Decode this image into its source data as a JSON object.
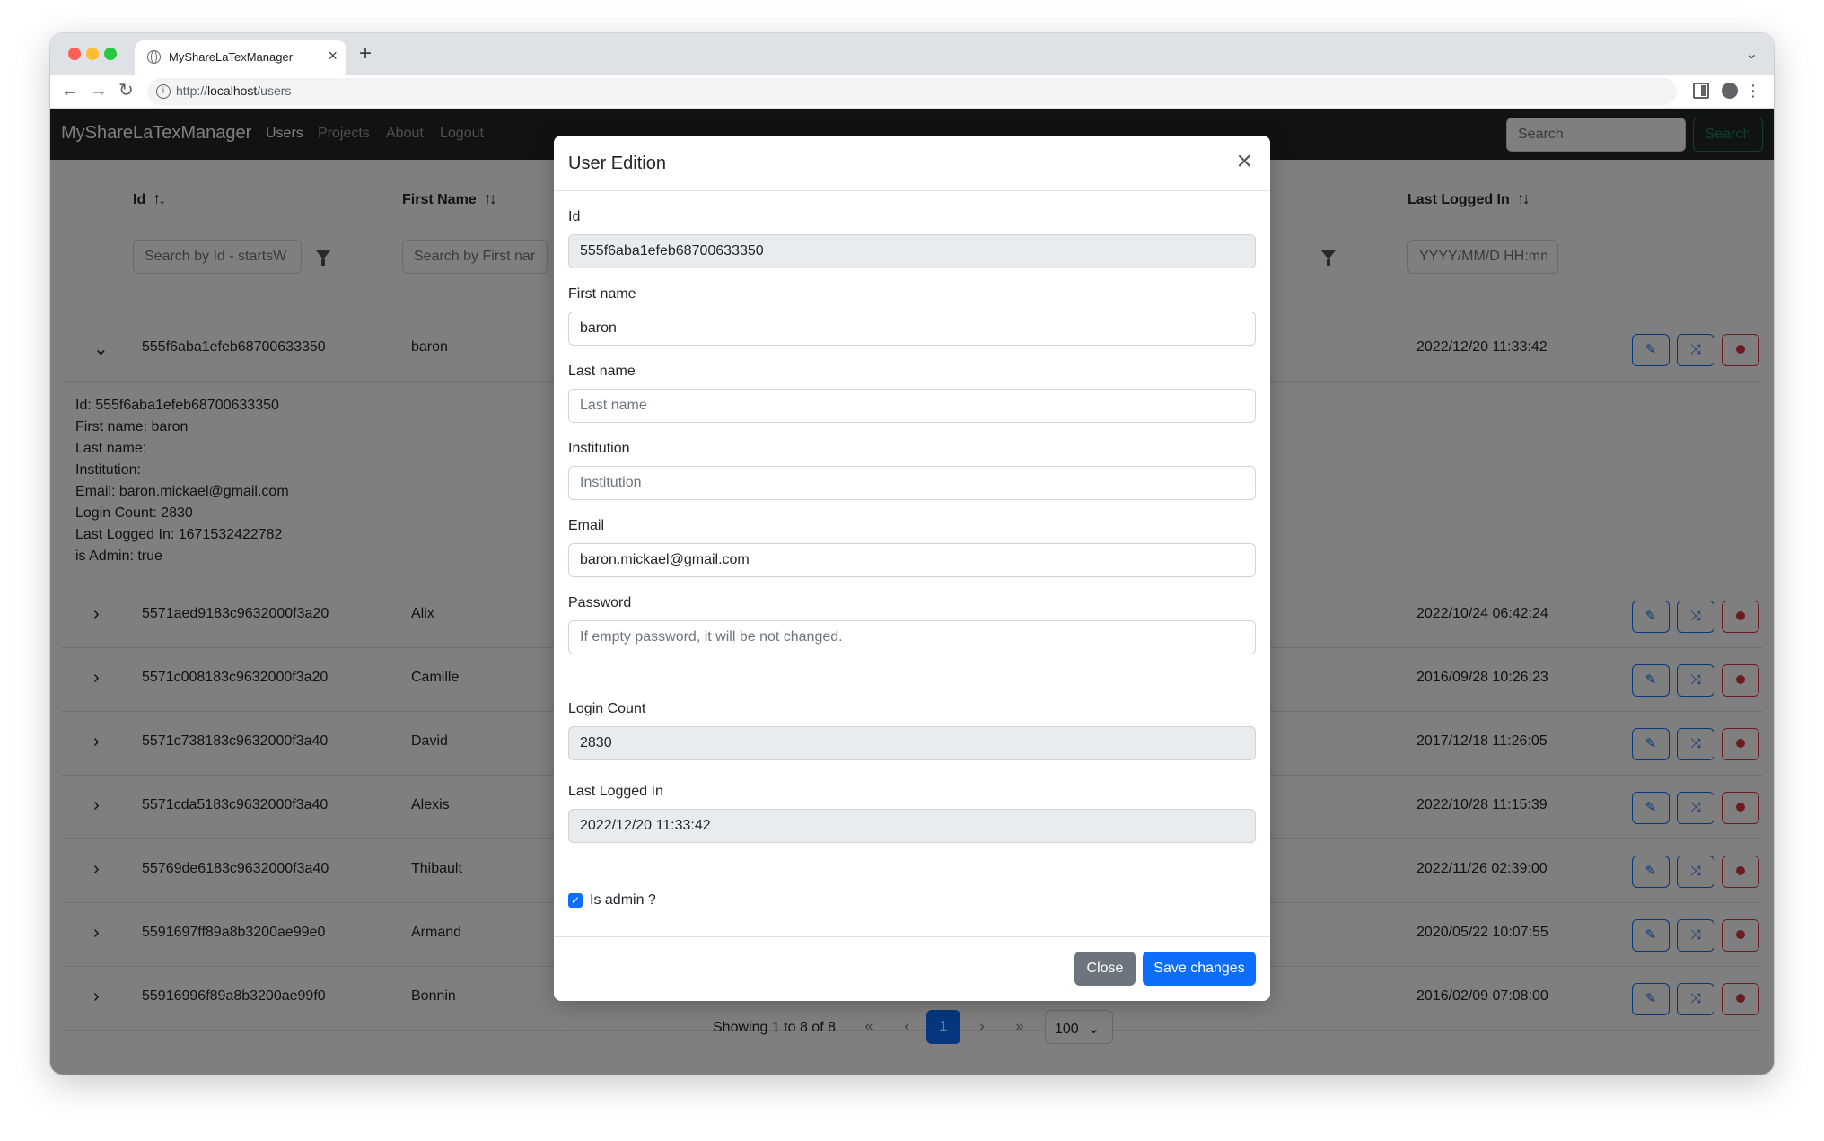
{
  "browser": {
    "tab_title": "MyShareLaTexManager",
    "url_prefix": "http://",
    "url_host": "localhost",
    "url_path": "/users"
  },
  "navbar": {
    "brand": "MyShareLaTexManager",
    "links": [
      "Users",
      "Projects",
      "About",
      "Logout"
    ],
    "search_placeholder": "Search",
    "search_button": "Search"
  },
  "table": {
    "headers": {
      "id": "Id",
      "first_name": "First Name",
      "last_logged_in": "Last Logged In"
    },
    "filters": {
      "id_placeholder": "Search by Id - startsW",
      "first_name_placeholder": "Search by First nar",
      "date_placeholder": "YYYY/MM/D HH:mn"
    },
    "rows": [
      {
        "id": "555f6aba1efeb68700633350",
        "first_name": "baron",
        "last_logged_in": "2022/12/20 11:33:42"
      },
      {
        "id": "5571aed9183c9632000f3a20",
        "first_name": "Alix",
        "last_logged_in": "2022/10/24 06:42:24"
      },
      {
        "id": "5571c008183c9632000f3a20",
        "first_name": "Camille",
        "last_logged_in": "2016/09/28 10:26:23"
      },
      {
        "id": "5571c738183c9632000f3a40",
        "first_name": "David",
        "last_logged_in": "2017/12/18 11:26:05"
      },
      {
        "id": "5571cda5183c9632000f3a40",
        "first_name": "Alexis",
        "last_logged_in": "2022/10/28 11:15:39"
      },
      {
        "id": "55769de6183c9632000f3a40",
        "first_name": "Thibault",
        "last_logged_in": "2022/11/26 02:39:00"
      },
      {
        "id": "5591697ff89a8b3200ae99e0",
        "first_name": "Armand",
        "last_logged_in": "2020/05/22 10:07:55"
      },
      {
        "id": "55916996f89a8b3200ae99f0",
        "first_name": "Bonnin",
        "last_logged_in": "2016/02/09 07:08:00"
      }
    ],
    "expanded_details": [
      "Id: 555f6aba1efeb68700633350",
      "First name: baron",
      "Last name:",
      "Institution:",
      "Email: baron.mickael@gmail.com",
      "Login Count: 2830",
      "Last Logged In: 1671532422782",
      "is Admin: true"
    ],
    "pagination": {
      "summary": "Showing 1 to 8 of 8",
      "first": "«",
      "prev": "‹",
      "current": "1",
      "next": "›",
      "last": "»",
      "page_size": "100"
    }
  },
  "modal": {
    "title": "User Edition",
    "fields": {
      "id_label": "Id",
      "id_value": "555f6aba1efeb68700633350",
      "first_name_label": "First name",
      "first_name_value": "baron",
      "last_name_label": "Last name",
      "last_name_placeholder": "Last name",
      "institution_label": "Institution",
      "institution_placeholder": "Institution",
      "email_label": "Email",
      "email_value": "baron.mickael@gmail.com",
      "password_label": "Password",
      "password_placeholder": "If empty password, it will be not changed.",
      "login_count_label": "Login Count",
      "login_count_value": "2830",
      "last_logged_label": "Last Logged In",
      "last_logged_value": "2022/12/20 11:33:42",
      "is_admin_label": "Is admin ?",
      "is_admin": true
    },
    "buttons": {
      "close": "Close",
      "save": "Save changes"
    }
  }
}
